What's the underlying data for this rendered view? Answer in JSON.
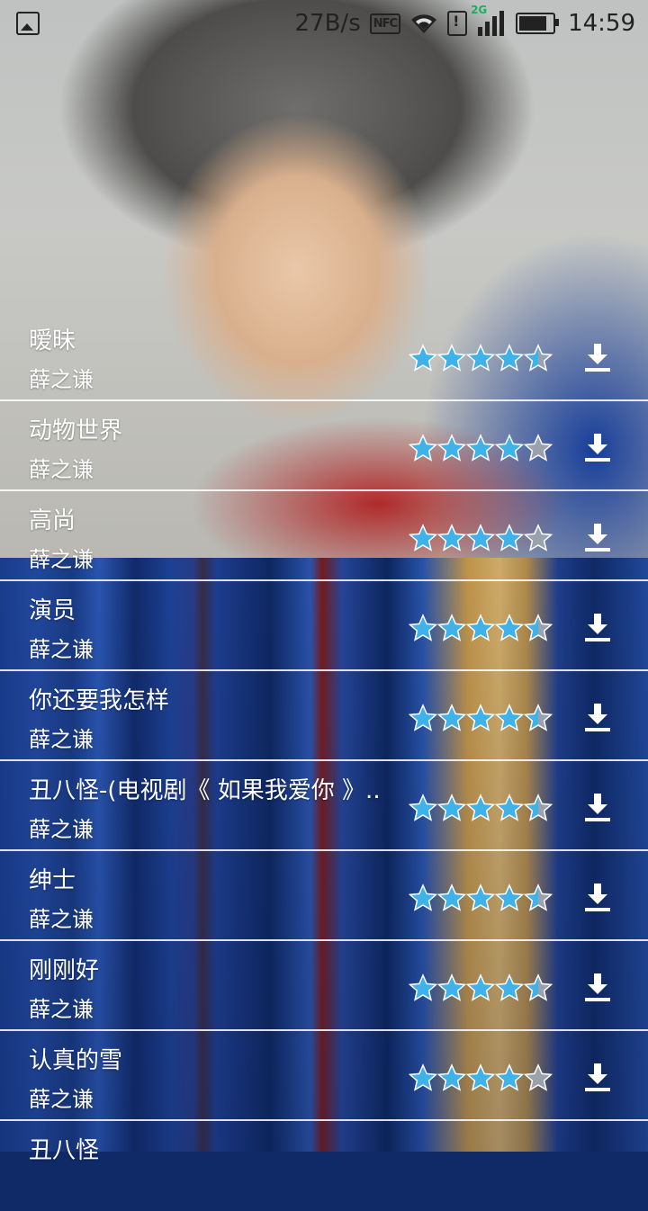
{
  "status_bar": {
    "speed": "27B/s",
    "nfc": "NFC",
    "network": "2G",
    "time": "14:59",
    "battery_level": 0.85
  },
  "colors": {
    "star_filled": "#3fb2ea",
    "star_empty": "#9aa3ad",
    "divider": "#ffffff"
  },
  "songs": [
    {
      "title": "暧昧",
      "artist": "薛之谦",
      "rating": 4.5
    },
    {
      "title": "动物世界",
      "artist": "薛之谦",
      "rating": 4
    },
    {
      "title": "高尚",
      "artist": "薛之谦",
      "rating": 4
    },
    {
      "title": "演员",
      "artist": "薛之谦",
      "rating": 4.5
    },
    {
      "title": "你还要我怎样",
      "artist": "薛之谦",
      "rating": 4.5
    },
    {
      "title": "丑八怪-(电视剧《 如果我爱你 》..",
      "artist": "薛之谦",
      "rating": 4.5
    },
    {
      "title": "绅士",
      "artist": "薛之谦",
      "rating": 4.5
    },
    {
      "title": "刚刚好",
      "artist": "薛之谦",
      "rating": 4.5
    },
    {
      "title": "认真的雪",
      "artist": "薛之谦",
      "rating": 4
    },
    {
      "title": "丑八怪",
      "artist": "",
      "rating": 0
    }
  ]
}
